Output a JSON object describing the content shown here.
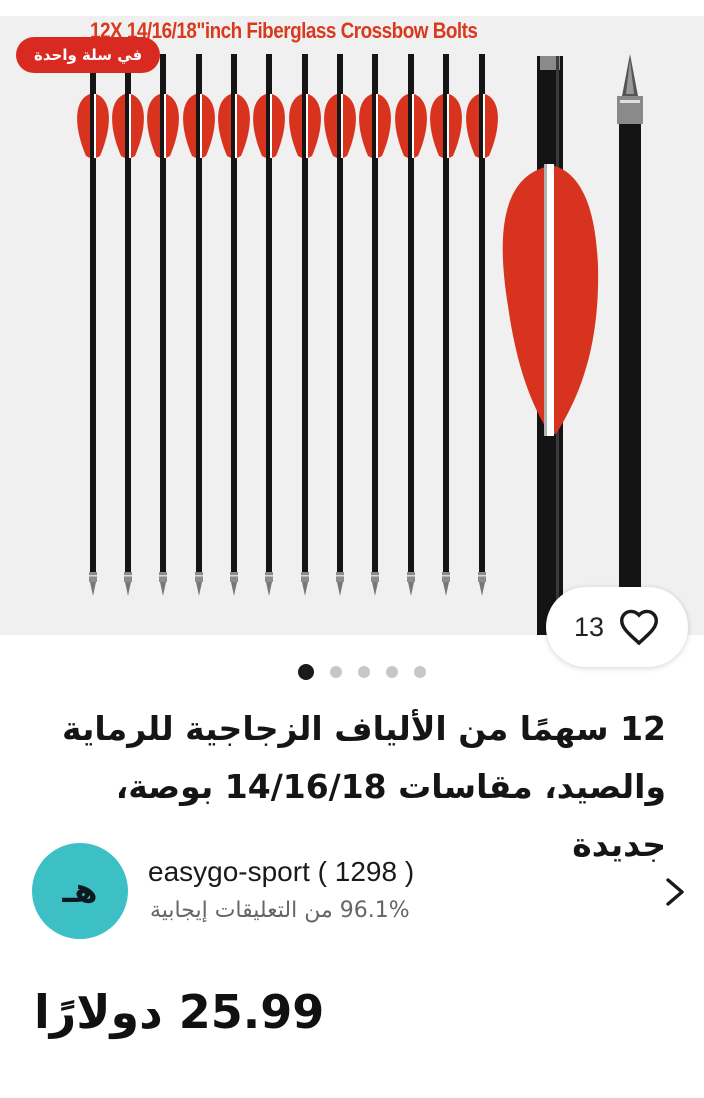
{
  "image": {
    "banner_text": "12X 14/16/18\"inch Fiberglass Crossbow Bolts",
    "badge_label": "في سلة واحدة",
    "like_count": "13",
    "carousel": {
      "total": 5,
      "active_index": 0
    }
  },
  "product": {
    "title": "12 سهمًا من الألياف الزجاجية للرماية والصيد، مقاسات 14/16/18 بوصة، جديدة"
  },
  "seller": {
    "avatar_letter": "هـ",
    "name": "easygo-sport",
    "rating_count": "( 1298 )",
    "feedback": "96.1% من التعليقات إيجابية"
  },
  "price": {
    "amount": "25.99",
    "currency": "دولارًا"
  },
  "colors": {
    "badge_bg": "#d92a22",
    "avatar_bg": "#3cc0c6",
    "fletching": "#d8331f",
    "banner_text": "#d83a1e"
  },
  "icons": {
    "like": "heart-outline-icon",
    "seller_link": "chevron-right-icon"
  }
}
